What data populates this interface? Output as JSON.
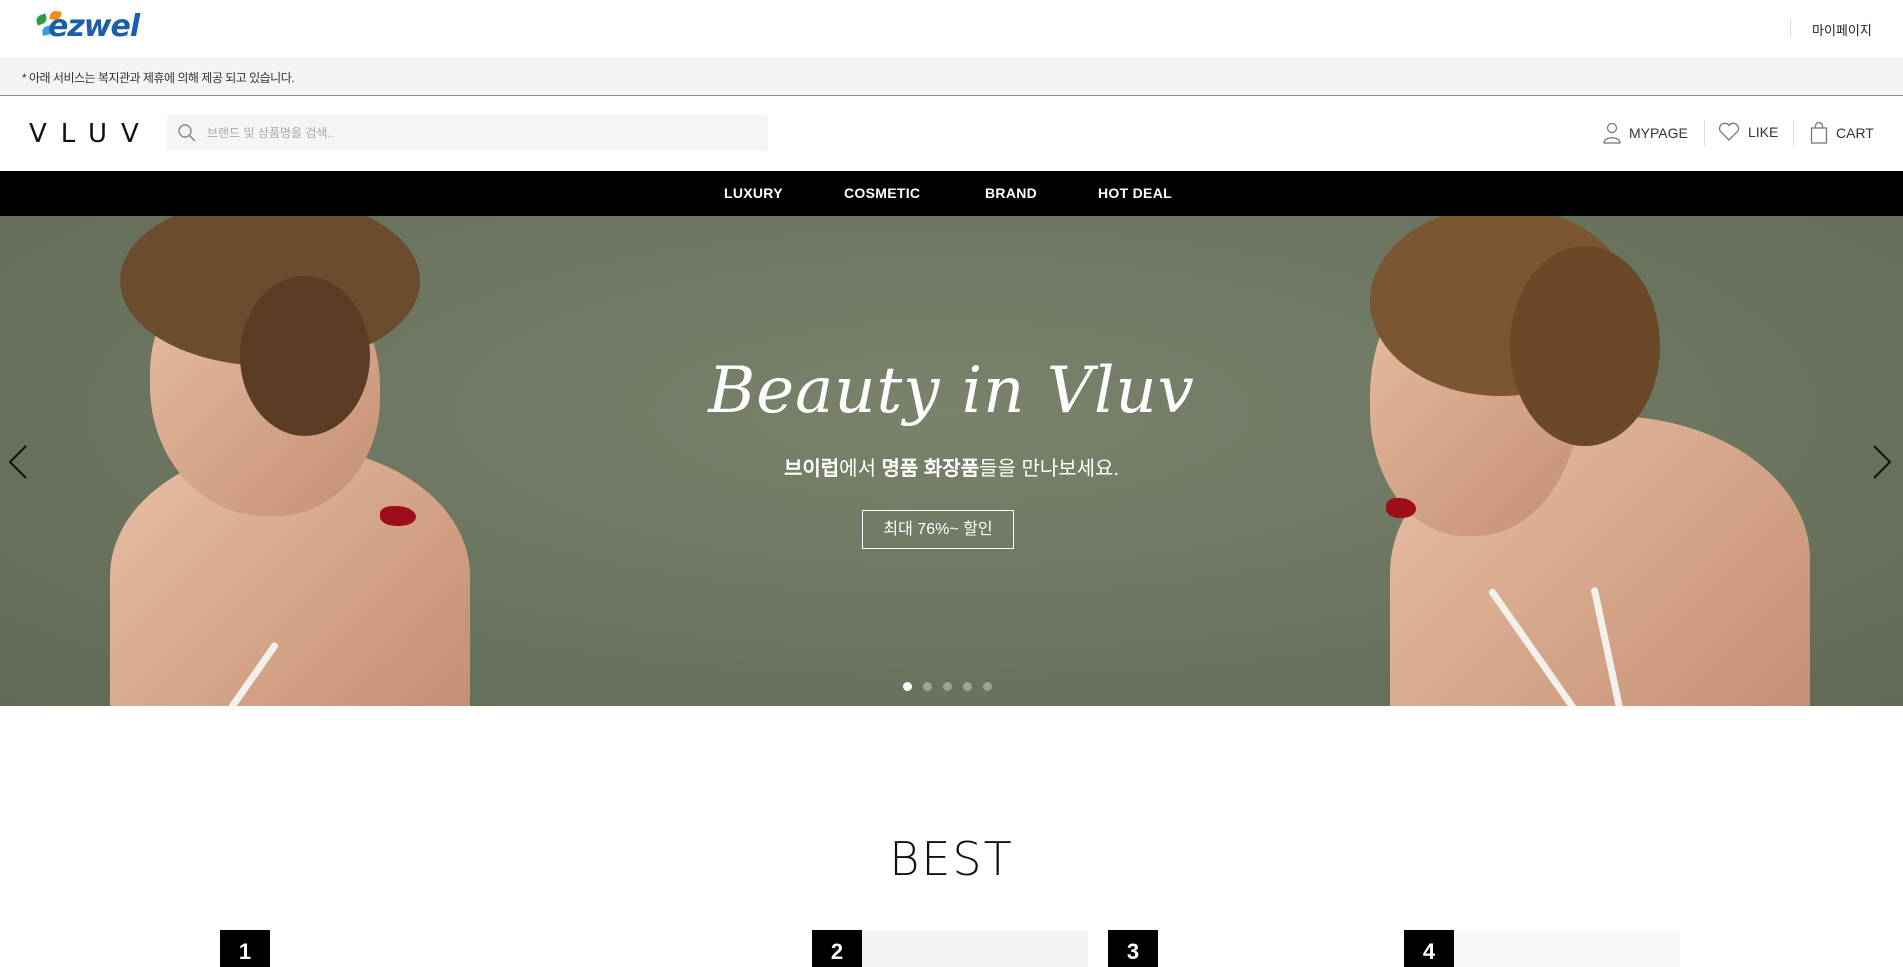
{
  "topbar": {
    "logo_text": "ezwel",
    "mypage_label": "마이페이지"
  },
  "notice": {
    "text": "* 아래 서비스는 복지관과 제휴에 의해 제공 되고 있습니다."
  },
  "header": {
    "logo_text": "VLUV",
    "search_placeholder": "브랜드 및 상품명을 검색..",
    "mypage_label": "MYPAGE",
    "like_label": "LIKE",
    "cart_label": "CART"
  },
  "nav": {
    "items": [
      "LUXURY",
      "COSMETIC",
      "BRAND",
      "HOT DEAL"
    ]
  },
  "hero": {
    "title": "Beauty in Vluv",
    "subtitle_parts": [
      "브이럽",
      "에서 ",
      "명품 화장품",
      "들을 만나보세요."
    ],
    "button_label": "최대 76%~ 할인",
    "slide_count": 5,
    "active_slide": 1,
    "background_color": "#6b7560"
  },
  "best": {
    "title": "BEST",
    "ranks": [
      "1",
      "2",
      "3",
      "4"
    ]
  },
  "colors": {
    "nav_bg": "#000000",
    "ezwel_blue": "#1b5fa8",
    "lip_red": "#9e0e1a"
  }
}
